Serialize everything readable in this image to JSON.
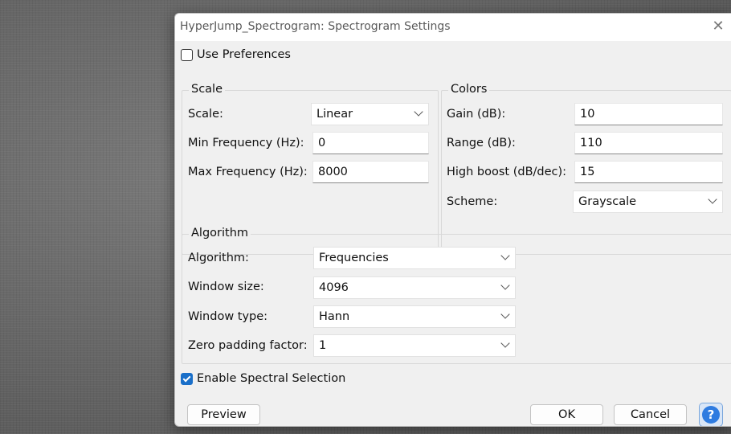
{
  "window": {
    "title": "HyperJump_Spectrogram: Spectrogram Settings",
    "close_glyph": "✕"
  },
  "use_preferences": {
    "label": "Use Preferences",
    "checked": false
  },
  "scale_group": {
    "legend": "Scale",
    "scale_label": "Scale:",
    "scale_value": "Linear",
    "min_freq_label": "Min Frequency (Hz):",
    "min_freq_value": "0",
    "max_freq_label": "Max Frequency (Hz):",
    "max_freq_value": "8000"
  },
  "colors_group": {
    "legend": "Colors",
    "gain_label": "Gain (dB):",
    "gain_value": "10",
    "range_label": "Range (dB):",
    "range_value": "110",
    "high_boost_label": "High boost (dB/dec):",
    "high_boost_value": "15",
    "scheme_label": "Scheme:",
    "scheme_value": "Grayscale"
  },
  "algorithm_group": {
    "legend": "Algorithm",
    "algorithm_label": "Algorithm:",
    "algorithm_value": "Frequencies",
    "window_size_label": "Window size:",
    "window_size_value": "4096",
    "window_type_label": "Window type:",
    "window_type_value": "Hann",
    "zero_padding_label": "Zero padding factor:",
    "zero_padding_value": "1"
  },
  "spectral_selection": {
    "label": "Enable Spectral Selection",
    "checked": true
  },
  "buttons": {
    "preview": "Preview",
    "ok": "OK",
    "cancel": "Cancel",
    "help": "?"
  },
  "colors": {
    "accent": "#1a6fc9",
    "help_blue": "#2e7be0"
  }
}
